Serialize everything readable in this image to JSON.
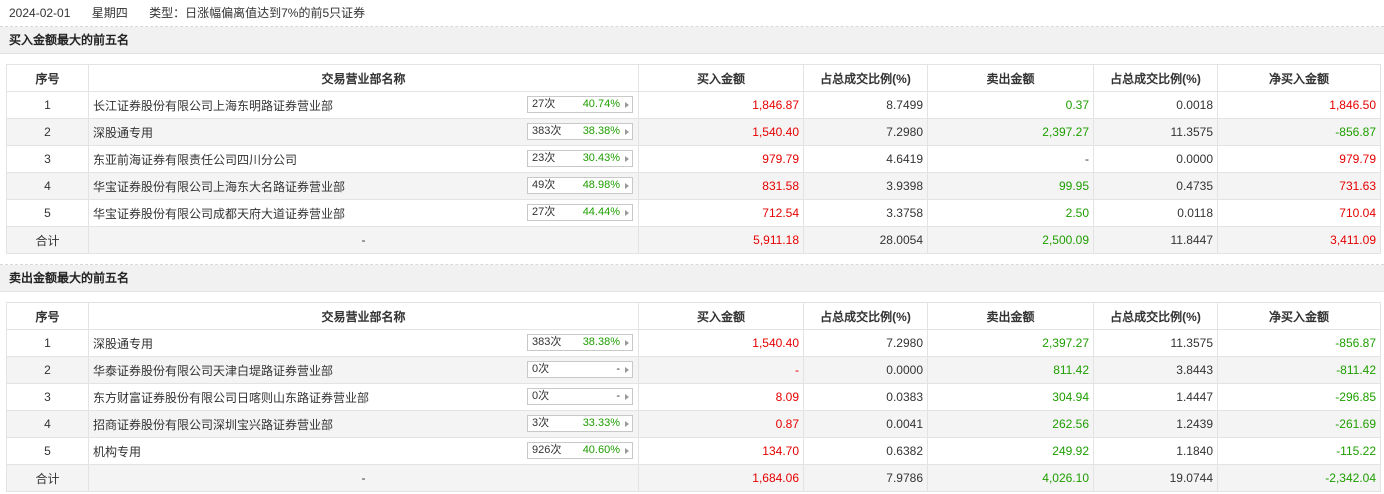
{
  "header": {
    "date": "2024-02-01",
    "weekday": "星期四",
    "type": "类型：日涨幅偏离值达到7%的前5只证券"
  },
  "columns": [
    "序号",
    "交易营业部名称",
    "买入金额",
    "占总成交比例(%)",
    "卖出金额",
    "占总成交比例(%)",
    "净买入金额"
  ],
  "buy_section": {
    "title": "买入金额最大的前五名",
    "rows": [
      {
        "no": "1",
        "name": "长江证券股份有限公司上海东明路证券营业部",
        "cnt": "27次",
        "pct": "40.74%",
        "buy": "1,846.87",
        "buy_ratio": "8.7499",
        "sell": "0.37",
        "sell_ratio": "0.0018",
        "net": "1,846.50"
      },
      {
        "no": "2",
        "name": "深股通专用",
        "cnt": "383次",
        "pct": "38.38%",
        "buy": "1,540.40",
        "buy_ratio": "7.2980",
        "sell": "2,397.27",
        "sell_ratio": "11.3575",
        "net": "-856.87"
      },
      {
        "no": "3",
        "name": "东亚前海证券有限责任公司四川分公司",
        "cnt": "23次",
        "pct": "30.43%",
        "buy": "979.79",
        "buy_ratio": "4.6419",
        "sell": "-",
        "sell_ratio": "0.0000",
        "net": "979.79"
      },
      {
        "no": "4",
        "name": "华宝证券股份有限公司上海东大名路证券营业部",
        "cnt": "49次",
        "pct": "48.98%",
        "buy": "831.58",
        "buy_ratio": "3.9398",
        "sell": "99.95",
        "sell_ratio": "0.4735",
        "net": "731.63"
      },
      {
        "no": "5",
        "name": "华宝证券股份有限公司成都天府大道证券营业部",
        "cnt": "27次",
        "pct": "44.44%",
        "buy": "712.54",
        "buy_ratio": "3.3758",
        "sell": "2.50",
        "sell_ratio": "0.0118",
        "net": "710.04"
      }
    ],
    "total": {
      "label": "合计",
      "name": "-",
      "buy": "5,911.18",
      "buy_ratio": "28.0054",
      "sell": "2,500.09",
      "sell_ratio": "11.8447",
      "net": "3,411.09"
    }
  },
  "sell_section": {
    "title": "卖出金额最大的前五名",
    "rows": [
      {
        "no": "1",
        "name": "深股通专用",
        "cnt": "383次",
        "pct": "38.38%",
        "buy": "1,540.40",
        "buy_ratio": "7.2980",
        "sell": "2,397.27",
        "sell_ratio": "11.3575",
        "net": "-856.87"
      },
      {
        "no": "2",
        "name": "华泰证券股份有限公司天津白堤路证券营业部",
        "cnt": "0次",
        "pct": "-",
        "buy": "-",
        "buy_ratio": "0.0000",
        "sell": "811.42",
        "sell_ratio": "3.8443",
        "net": "-811.42"
      },
      {
        "no": "3",
        "name": "东方财富证券股份有限公司日喀则山东路证券营业部",
        "cnt": "0次",
        "pct": "-",
        "buy": "8.09",
        "buy_ratio": "0.0383",
        "sell": "304.94",
        "sell_ratio": "1.4447",
        "net": "-296.85"
      },
      {
        "no": "4",
        "name": "招商证券股份有限公司深圳宝兴路证券营业部",
        "cnt": "3次",
        "pct": "33.33%",
        "buy": "0.87",
        "buy_ratio": "0.0041",
        "sell": "262.56",
        "sell_ratio": "1.2439",
        "net": "-261.69"
      },
      {
        "no": "5",
        "name": "机构专用",
        "cnt": "926次",
        "pct": "40.60%",
        "buy": "134.70",
        "buy_ratio": "0.6382",
        "sell": "249.92",
        "sell_ratio": "1.1840",
        "net": "-115.22"
      }
    ],
    "total": {
      "label": "合计",
      "name": "-",
      "buy": "1,684.06",
      "buy_ratio": "7.9786",
      "sell": "4,026.10",
      "sell_ratio": "19.0744",
      "net": "-2,342.04"
    }
  }
}
